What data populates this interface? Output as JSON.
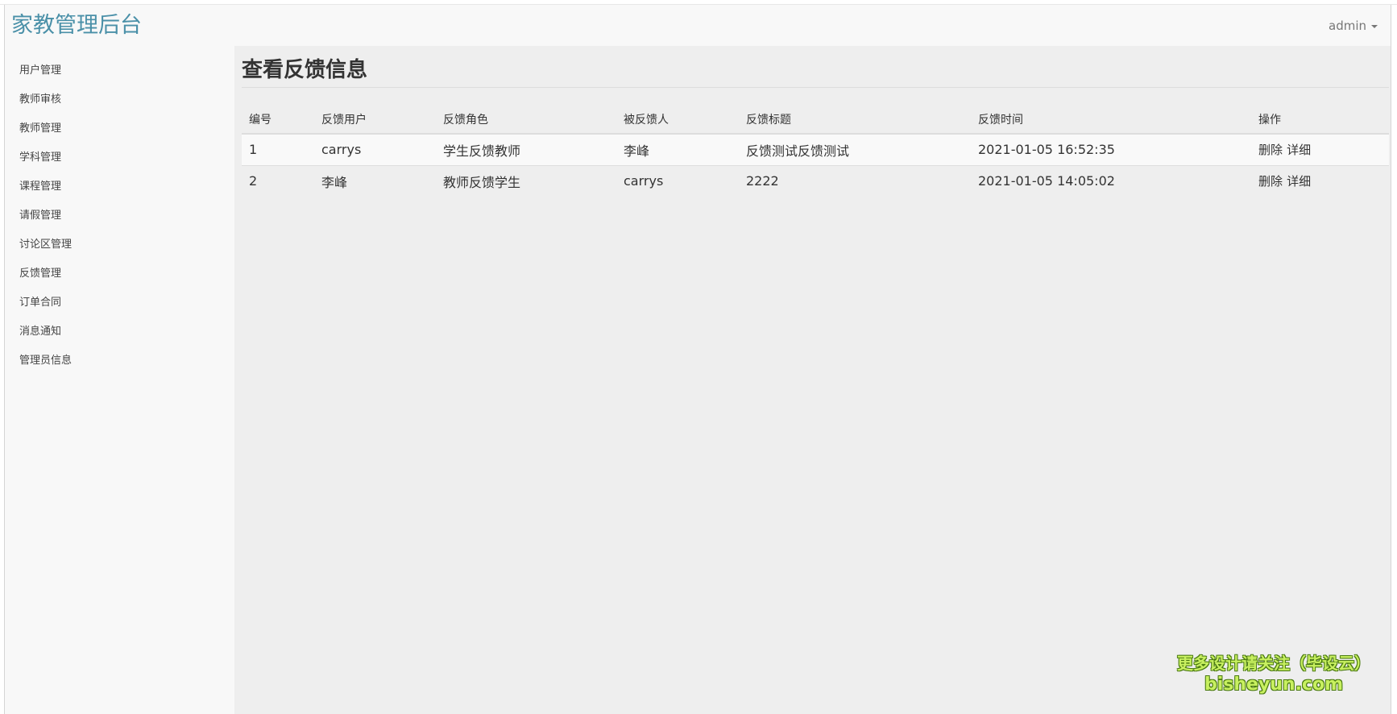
{
  "header": {
    "brand": "家教管理后台",
    "user": "admin"
  },
  "sidebar": {
    "items": [
      {
        "label": "用户管理"
      },
      {
        "label": "教师审核"
      },
      {
        "label": "教师管理"
      },
      {
        "label": "学科管理"
      },
      {
        "label": "课程管理"
      },
      {
        "label": "请假管理"
      },
      {
        "label": "讨论区管理"
      },
      {
        "label": "反馈管理"
      },
      {
        "label": "订单合同"
      },
      {
        "label": "消息通知"
      },
      {
        "label": "管理员信息"
      }
    ]
  },
  "main": {
    "title": "查看反馈信息",
    "table": {
      "columns": [
        "编号",
        "反馈用户",
        "反馈角色",
        "被反馈人",
        "反馈标题",
        "反馈时间",
        "操作"
      ],
      "rows": [
        {
          "id": "1",
          "user": "carrys",
          "role": "学生反馈教师",
          "target": "李峰",
          "subject": "反馈测试反馈测试",
          "time": "2021-01-05 16:52:35",
          "delete": "删除",
          "detail": "详细"
        },
        {
          "id": "2",
          "user": "李峰",
          "role": "教师反馈学生",
          "target": "carrys",
          "subject": "2222",
          "time": "2021-01-05 14:05:02",
          "delete": "删除",
          "detail": "详细"
        }
      ]
    }
  },
  "watermark": {
    "line1": "更多设计请关注（毕设云）",
    "line2": "bisheyun.com"
  },
  "colors": {
    "brand": "#4a90a8",
    "sidebar_bg": "#f8f8f8",
    "main_bg": "#eeeeee"
  }
}
